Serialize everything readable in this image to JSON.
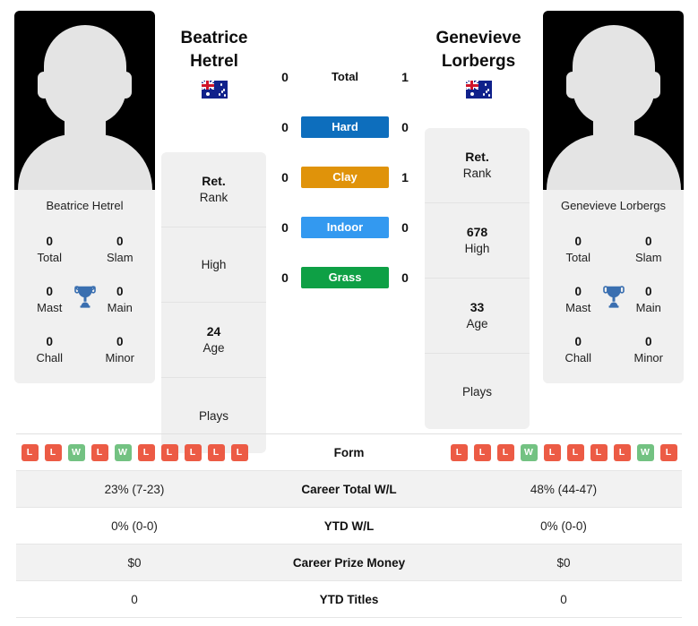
{
  "players": {
    "left": {
      "first_name": "Beatrice",
      "last_name": "Hetrel",
      "full_name": "Beatrice Hetrel",
      "country": "Australia",
      "flag_icon": "australia-flag-icon",
      "avatar_icon": "player-silhouette-icon",
      "titles": [
        {
          "value": "0",
          "label": "Total"
        },
        {
          "value": "0",
          "label": "Slam"
        },
        {
          "value": "0",
          "label": "Mast"
        },
        {
          "value": "0",
          "label": "Main"
        },
        {
          "value": "0",
          "label": "Chall"
        },
        {
          "value": "0",
          "label": "Minor"
        }
      ],
      "trophy_icon": "trophy-icon",
      "stats": [
        {
          "value": "Ret.",
          "label": "Rank"
        },
        {
          "value": "",
          "label": "High"
        },
        {
          "value": "24",
          "label": "Age"
        },
        {
          "value": "",
          "label": "Plays"
        }
      ],
      "form": [
        "L",
        "L",
        "W",
        "L",
        "W",
        "L",
        "L",
        "L",
        "L",
        "L"
      ]
    },
    "right": {
      "first_name": "Genevieve",
      "last_name": "Lorbergs",
      "full_name": "Genevieve Lorbergs",
      "country": "Australia",
      "flag_icon": "australia-flag-icon",
      "avatar_icon": "player-silhouette-icon",
      "titles": [
        {
          "value": "0",
          "label": "Total"
        },
        {
          "value": "0",
          "label": "Slam"
        },
        {
          "value": "0",
          "label": "Mast"
        },
        {
          "value": "0",
          "label": "Main"
        },
        {
          "value": "0",
          "label": "Chall"
        },
        {
          "value": "0",
          "label": "Minor"
        }
      ],
      "trophy_icon": "trophy-icon",
      "stats": [
        {
          "value": "Ret.",
          "label": "Rank"
        },
        {
          "value": "678",
          "label": "High"
        },
        {
          "value": "33",
          "label": "Age"
        },
        {
          "value": "",
          "label": "Plays"
        }
      ],
      "form": [
        "L",
        "L",
        "L",
        "W",
        "L",
        "L",
        "L",
        "L",
        "W",
        "L"
      ]
    }
  },
  "head_to_head": [
    {
      "surface": "Total",
      "left": "0",
      "right": "1",
      "color": "",
      "plain": true
    },
    {
      "surface": "Hard",
      "left": "0",
      "right": "0",
      "color": "#0d6ebd",
      "plain": false
    },
    {
      "surface": "Clay",
      "left": "0",
      "right": "1",
      "color": "#e0930a",
      "plain": false
    },
    {
      "surface": "Indoor",
      "left": "0",
      "right": "0",
      "color": "#3399f0",
      "plain": false
    },
    {
      "surface": "Grass",
      "left": "0",
      "right": "0",
      "color": "#0ea045",
      "plain": false
    }
  ],
  "comparison_table": [
    {
      "label": "Form",
      "left": "",
      "right": "",
      "type": "form"
    },
    {
      "label": "Career Total W/L",
      "left": "23% (7-23)",
      "right": "48% (44-47)",
      "type": "text"
    },
    {
      "label": "YTD W/L",
      "left": "0% (0-0)",
      "right": "0% (0-0)",
      "type": "text"
    },
    {
      "label": "Career Prize Money",
      "left": "$0",
      "right": "$0",
      "type": "text"
    },
    {
      "label": "YTD Titles",
      "left": "0",
      "right": "0",
      "type": "text"
    }
  ],
  "colors": {
    "hard": "#0d6ebd",
    "clay": "#e0930a",
    "indoor": "#3399f0",
    "grass": "#0ea045",
    "win": "#73c282",
    "loss": "#ec5b45",
    "trophy": "#3a6fb0",
    "card_bg": "#f0f0f0",
    "row_alt_bg": "#f2f2f2"
  }
}
